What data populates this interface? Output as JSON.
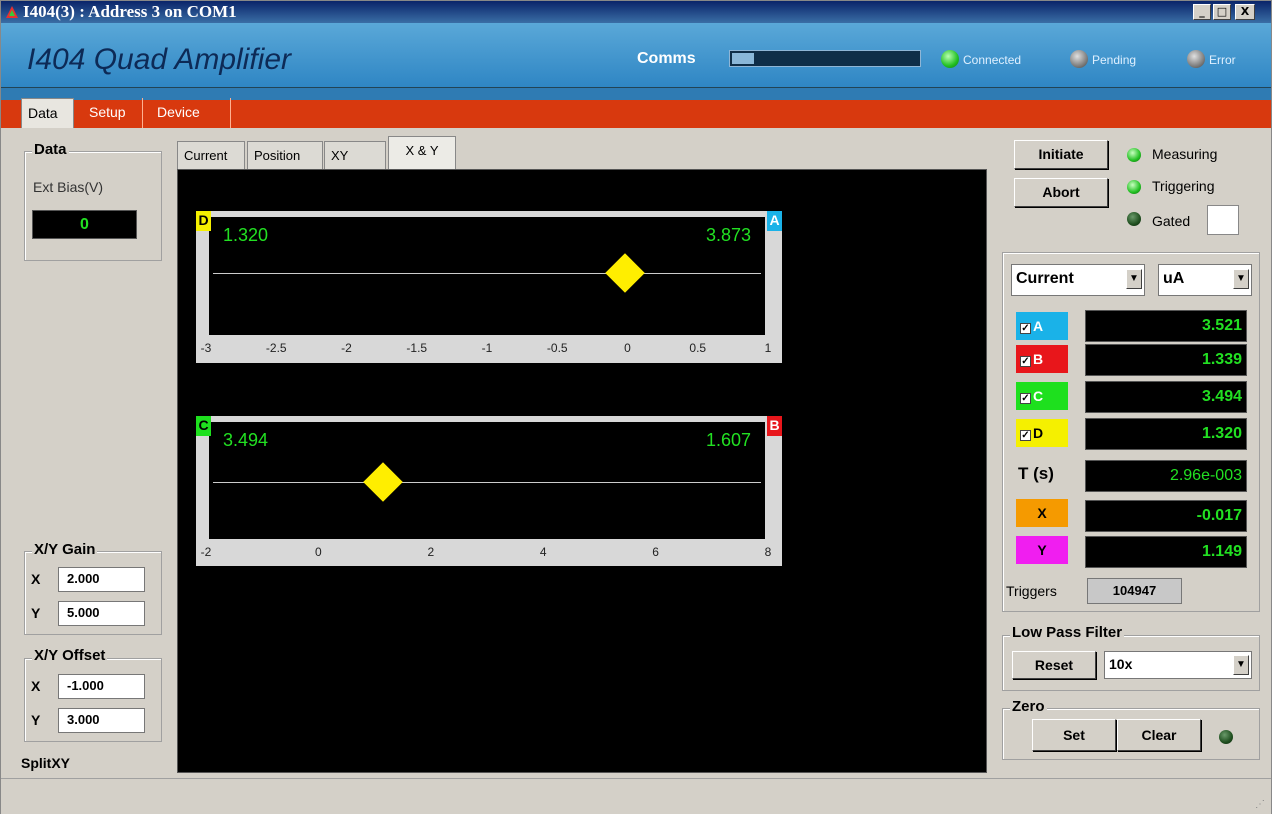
{
  "window": {
    "title": "I404(3) : Address 3 on COM1",
    "minimize": "_",
    "maximize": "□",
    "close": "X"
  },
  "header": {
    "app_title": "I404 Quad Amplifier",
    "comms_label": "Comms",
    "comms_progress": 0.12,
    "connected_label": "Connected",
    "pending_label": "Pending",
    "error_label": "Error"
  },
  "tabs": {
    "data": "Data",
    "setup": "Setup",
    "device": "Device"
  },
  "data_group": {
    "title": "Data",
    "ext_bias_label": "Ext Bias(V)",
    "ext_bias_value": "0"
  },
  "gain_group": {
    "title": "X/Y Gain",
    "x_label": "X",
    "x_value": "2.000",
    "y_label": "Y",
    "y_value": "5.000"
  },
  "offset_group": {
    "title": "X/Y Offset",
    "x_label": "X",
    "x_value": "-1.000",
    "y_label": "Y",
    "y_value": "3.000"
  },
  "mode_label": "SplitXY",
  "inner_tabs": [
    "Current",
    "Position",
    "XY",
    "X & Y"
  ],
  "x_bar": {
    "left_tag": "D",
    "right_tag": "A",
    "left_value": "1.320",
    "right_value": "3.873",
    "ticks": [
      "-3",
      "-2.5",
      "-2",
      "-1.5",
      "-1",
      "-0.5",
      "0",
      "0.5",
      "1"
    ],
    "marker_value": -0.017
  },
  "y_bar": {
    "left_tag": "C",
    "right_tag": "B",
    "left_value": "3.494",
    "right_value": "1.607",
    "ticks": [
      "-2",
      "0",
      "2",
      "4",
      "6",
      "8"
    ],
    "marker_value": 1.149
  },
  "controls": {
    "initiate": "Initiate",
    "abort": "Abort",
    "measuring": "Measuring",
    "triggering": "Triggering",
    "gated": "Gated"
  },
  "readout": {
    "mode": "Current",
    "unit": "uA",
    "channels": [
      {
        "label": "A",
        "value": "3.521",
        "color": "#1ab2e8"
      },
      {
        "label": "B",
        "value": "1.339",
        "color": "#e8161b"
      },
      {
        "label": "C",
        "value": "3.494",
        "color": "#1ee01e"
      },
      {
        "label": "D",
        "value": "1.320",
        "color": "#f5f000"
      }
    ],
    "t_label": "T (s)",
    "t_value": "2.96e-003",
    "x_label": "X",
    "x_value": "-0.017",
    "x_color": "#f59a00",
    "y_label": "Y",
    "y_value": "1.149",
    "y_color": "#f01ef0",
    "triggers_label": "Triggers",
    "triggers_value": "104947"
  },
  "filter": {
    "title": "Low Pass Filter",
    "reset": "Reset",
    "value": "10x"
  },
  "zero": {
    "title": "Zero",
    "set": "Set",
    "clear": "Clear"
  }
}
